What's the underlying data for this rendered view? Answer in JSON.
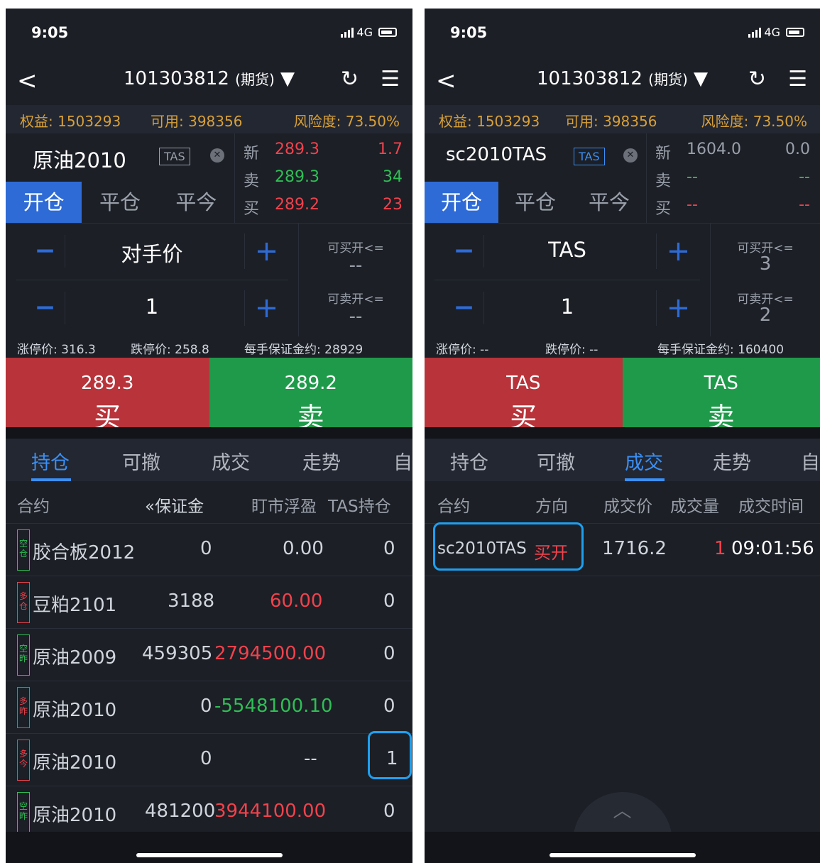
{
  "left": {
    "status": {
      "time": "9:05",
      "network": "4G"
    },
    "nav": {
      "title": "101303812",
      "suffix": "(期货)"
    },
    "account": {
      "equity": "权益: 1503293",
      "available": "可用: 398356",
      "risk": "风险度: 73.50%"
    },
    "contract": {
      "name": "原油2010",
      "tag": "TAS"
    },
    "mode_tabs": [
      "开仓",
      "平仓",
      "平今"
    ],
    "quote": [
      {
        "label": "新",
        "price": "289.3",
        "vol": "1.7"
      },
      {
        "label": "卖",
        "price": "289.3",
        "vol": "34"
      },
      {
        "label": "买",
        "price": "289.2",
        "vol": "23"
      }
    ],
    "order": {
      "price_mode": "对手价",
      "qty": "1"
    },
    "avail": {
      "buy_label": "可买开<=",
      "buy_value": "--",
      "sell_label": "可卖开<=",
      "sell_value": "--"
    },
    "limits": {
      "up": "涨停价: 316.3",
      "down": "跌停价: 258.8",
      "margin": "每手保证金约: 28929"
    },
    "buy_btn": {
      "price": "289.3",
      "action": "买"
    },
    "sell_btn": {
      "price": "289.2",
      "action": "卖"
    },
    "tabs": [
      "持仓",
      "可撤",
      "成交",
      "走势",
      "自"
    ],
    "table_header": [
      "合约",
      "«保证金",
      "盯市浮盈",
      "TAS持仓"
    ],
    "rows": [
      {
        "badge": "空仓",
        "name": "胶合板2012",
        "margin": "0",
        "pnl": "0.00",
        "tas": "0"
      },
      {
        "badge": "多仓",
        "name": "豆粕2101",
        "margin": "3188",
        "pnl": "60.00",
        "tas": "0"
      },
      {
        "badge": "空昨",
        "name": "原油2009",
        "margin": "459305",
        "pnl": "2794500.00",
        "tas": "0"
      },
      {
        "badge": "多昨",
        "name": "原油2010",
        "margin": "0",
        "pnl": "-5548100.10",
        "tas": "0"
      },
      {
        "badge": "多今",
        "name": "原油2010",
        "margin": "0",
        "pnl": "--",
        "tas": "1"
      },
      {
        "badge": "空昨",
        "name": "原油2010",
        "margin": "481200",
        "pnl": "3944100.00",
        "tas": "0"
      }
    ]
  },
  "right": {
    "status": {
      "time": "9:05",
      "network": "4G"
    },
    "nav": {
      "title": "101303812",
      "suffix": "(期货)"
    },
    "account": {
      "equity": "权益: 1503293",
      "available": "可用: 398356",
      "risk": "风险度: 73.50%"
    },
    "contract": {
      "name": "sc2010TAS",
      "tag": "TAS"
    },
    "mode_tabs": [
      "开仓",
      "平仓",
      "平今"
    ],
    "quote": [
      {
        "label": "新",
        "price": "1604.0",
        "vol": "0.0"
      },
      {
        "label": "卖",
        "price": "--",
        "vol": "--"
      },
      {
        "label": "买",
        "price": "--",
        "vol": "--"
      }
    ],
    "order": {
      "price_mode": "TAS",
      "qty": "1"
    },
    "avail": {
      "buy_label": "可买开<=",
      "buy_value": "3",
      "sell_label": "可卖开<=",
      "sell_value": "2"
    },
    "limits": {
      "up": "涨停价: --",
      "down": "跌停价: --",
      "margin": "每手保证金约: 160400"
    },
    "buy_btn": {
      "price": "TAS",
      "action": "买"
    },
    "sell_btn": {
      "price": "TAS",
      "action": "卖"
    },
    "tabs": [
      "持仓",
      "可撤",
      "成交",
      "走势",
      "自"
    ],
    "table_header": [
      "合约",
      "方向",
      "成交价",
      "成交量",
      "成交时间"
    ],
    "trade": {
      "name": "sc2010TAS",
      "dir": "买开",
      "price": "1716.2",
      "qty": "1",
      "time": "09:01:56"
    }
  },
  "colors": {
    "accent": "#2e6bd6",
    "up": "#f0424c",
    "down": "#2fbf55",
    "gold": "#d8a039",
    "highlight": "#1ea0f0"
  }
}
